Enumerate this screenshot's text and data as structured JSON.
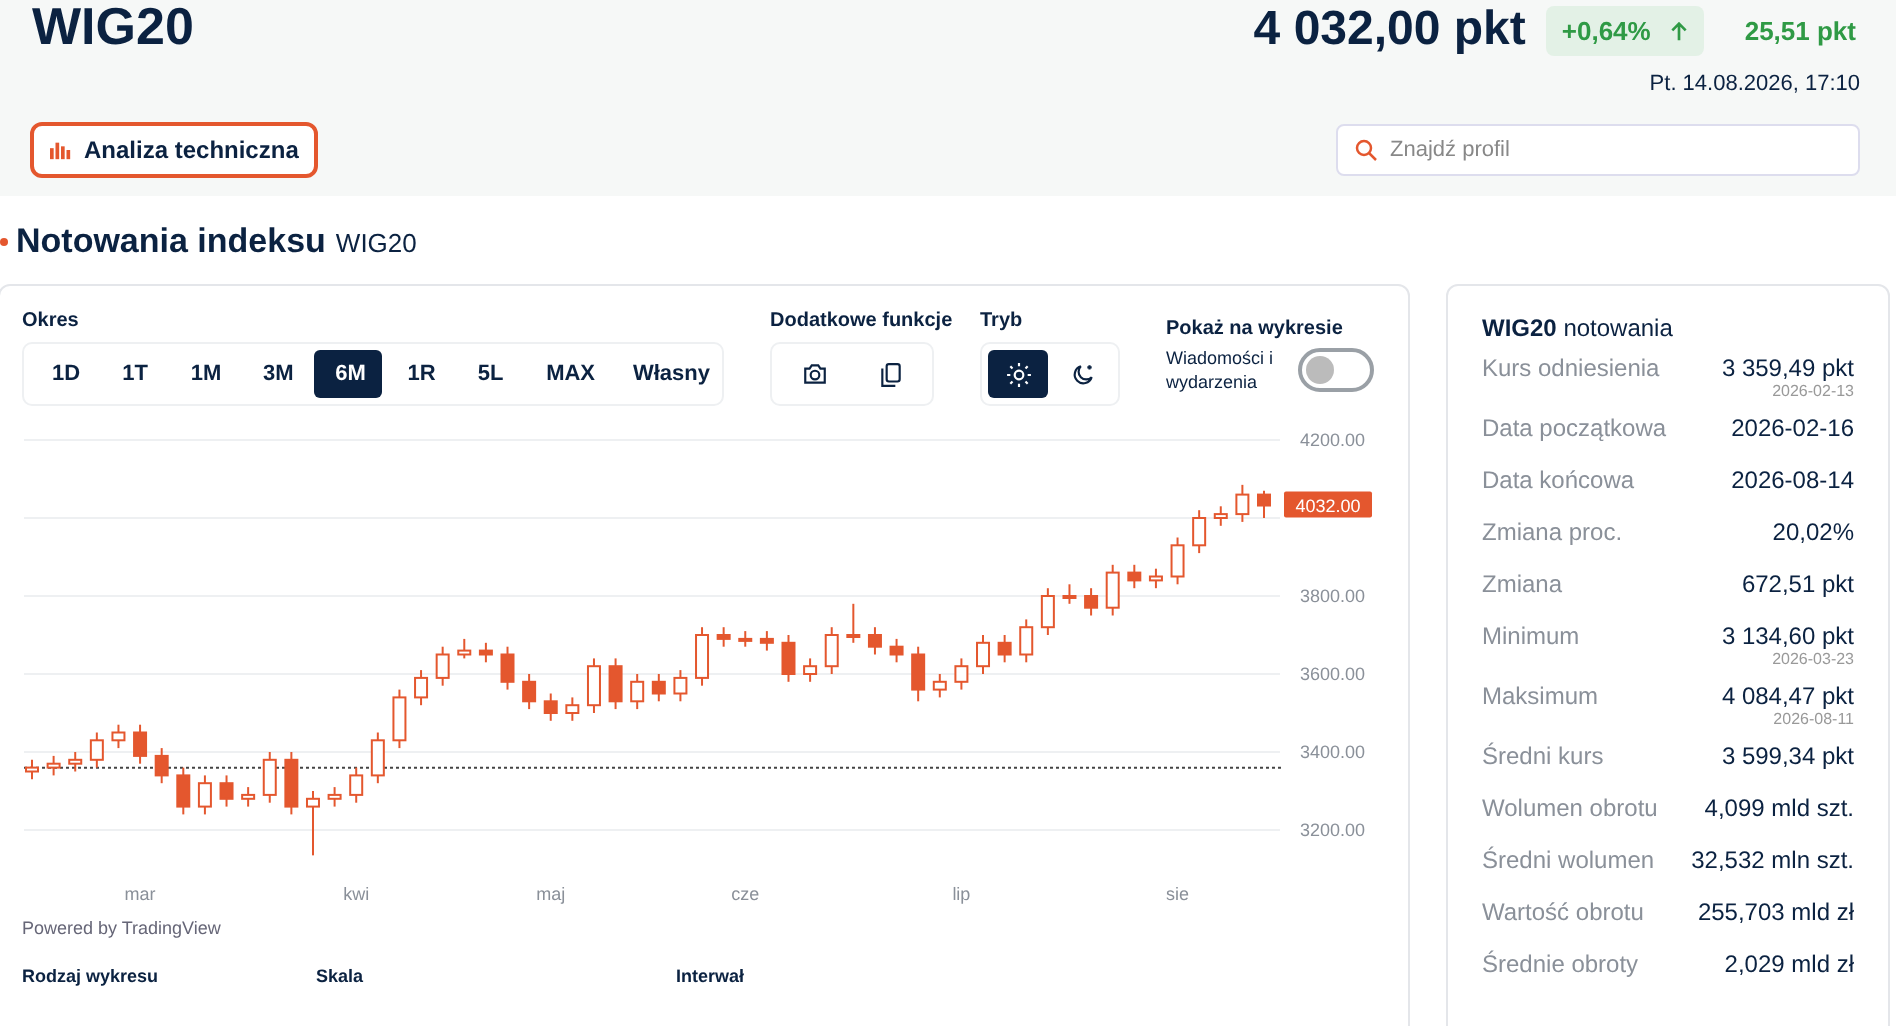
{
  "header": {
    "title": "WIG20",
    "price": "4 032,00 pkt",
    "change_pct": "+0,64%",
    "change_abs": "25,51 pkt",
    "timestamp": "Pt. 14.08.2026, 17:10",
    "analysis_button": "Analiza techniczna",
    "search": {
      "placeholder": "Znajdź profil"
    }
  },
  "section": {
    "title": "Notowania indeksu",
    "subtitle": "WIG20"
  },
  "controls": {
    "period_label": "Okres",
    "periods": [
      {
        "label": "1D",
        "selected": false
      },
      {
        "label": "1T",
        "selected": false
      },
      {
        "label": "1M",
        "selected": false
      },
      {
        "label": "3M",
        "selected": false
      },
      {
        "label": "6M",
        "selected": true
      },
      {
        "label": "1R",
        "selected": false
      },
      {
        "label": "5L",
        "selected": false
      },
      {
        "label": "MAX",
        "selected": false
      },
      {
        "label": "Własny",
        "selected": false
      }
    ],
    "extras_label": "Dodatkowe funkcje",
    "extras": [
      {
        "kind": "camera"
      },
      {
        "kind": "copy"
      }
    ],
    "mode_label": "Tryb",
    "modes": [
      {
        "kind": "light",
        "selected": true
      },
      {
        "kind": "dark",
        "selected": false
      }
    ],
    "show_label": "Pokaż na wykresie",
    "events": {
      "label": "Wiadomości i wydarzenia",
      "on": false
    }
  },
  "chart": {
    "footer": "Powered by TradingView",
    "bottom_labels": [
      "Rodzaj wykresu",
      "Skala",
      "Interwał"
    ],
    "chart_data": {
      "type": "candlestick",
      "grid": true,
      "ylim": [
        3200,
        4200
      ],
      "yticks": [
        {
          "value": 3200,
          "label": "3200.00"
        },
        {
          "value": 3400,
          "label": "3400.00"
        },
        {
          "value": 3600,
          "label": "3600.00"
        },
        {
          "value": 3800,
          "label": "3800.00"
        },
        {
          "value": 4200,
          "label": "4200.00"
        }
      ],
      "categories": [
        null,
        null,
        null,
        null,
        null,
        "mar",
        null,
        null,
        null,
        null,
        null,
        null,
        null,
        null,
        null,
        "kwi",
        null,
        null,
        null,
        null,
        null,
        null,
        null,
        null,
        "maj",
        null,
        null,
        null,
        null,
        null,
        null,
        null,
        null,
        "cze",
        null,
        null,
        null,
        null,
        null,
        null,
        null,
        null,
        null,
        "lip",
        null,
        null,
        null,
        null,
        null,
        null,
        null,
        null,
        null,
        "sie",
        null,
        null,
        null,
        null
      ],
      "ohlc": [
        [
          3350,
          3380,
          3330,
          3360
        ],
        [
          3360,
          3390,
          3340,
          3370
        ],
        [
          3370,
          3400,
          3350,
          3380
        ],
        [
          3380,
          3450,
          3360,
          3430
        ],
        [
          3430,
          3470,
          3410,
          3450
        ],
        [
          3450,
          3470,
          3370,
          3390
        ],
        [
          3390,
          3410,
          3320,
          3340
        ],
        [
          3340,
          3360,
          3240,
          3260
        ],
        [
          3260,
          3340,
          3240,
          3320
        ],
        [
          3320,
          3340,
          3260,
          3280
        ],
        [
          3280,
          3310,
          3260,
          3290
        ],
        [
          3290,
          3400,
          3270,
          3380
        ],
        [
          3380,
          3400,
          3240,
          3260
        ],
        [
          3260,
          3300,
          3135,
          3280
        ],
        [
          3280,
          3310,
          3260,
          3290
        ],
        [
          3290,
          3360,
          3270,
          3340
        ],
        [
          3340,
          3450,
          3320,
          3430
        ],
        [
          3430,
          3560,
          3410,
          3540
        ],
        [
          3540,
          3610,
          3520,
          3590
        ],
        [
          3590,
          3670,
          3570,
          3650
        ],
        [
          3650,
          3690,
          3640,
          3660
        ],
        [
          3660,
          3680,
          3630,
          3650
        ],
        [
          3650,
          3670,
          3560,
          3580
        ],
        [
          3580,
          3600,
          3510,
          3530
        ],
        [
          3530,
          3550,
          3480,
          3500
        ],
        [
          3500,
          3540,
          3480,
          3520
        ],
        [
          3520,
          3640,
          3500,
          3620
        ],
        [
          3620,
          3640,
          3510,
          3530
        ],
        [
          3530,
          3600,
          3510,
          3580
        ],
        [
          3580,
          3600,
          3530,
          3550
        ],
        [
          3550,
          3610,
          3530,
          3590
        ],
        [
          3590,
          3720,
          3570,
          3700
        ],
        [
          3700,
          3720,
          3670,
          3690
        ],
        [
          3690,
          3710,
          3670,
          3690
        ],
        [
          3690,
          3710,
          3660,
          3680
        ],
        [
          3680,
          3700,
          3580,
          3600
        ],
        [
          3600,
          3640,
          3580,
          3620
        ],
        [
          3620,
          3720,
          3600,
          3700
        ],
        [
          3700,
          3780,
          3680,
          3700
        ],
        [
          3700,
          3720,
          3650,
          3670
        ],
        [
          3670,
          3690,
          3630,
          3650
        ],
        [
          3650,
          3670,
          3530,
          3560
        ],
        [
          3560,
          3600,
          3540,
          3580
        ],
        [
          3580,
          3640,
          3560,
          3620
        ],
        [
          3620,
          3700,
          3600,
          3680
        ],
        [
          3680,
          3700,
          3630,
          3650
        ],
        [
          3650,
          3740,
          3630,
          3720
        ],
        [
          3720,
          3820,
          3700,
          3800
        ],
        [
          3800,
          3830,
          3780,
          3800
        ],
        [
          3800,
          3820,
          3750,
          3770
        ],
        [
          3770,
          3880,
          3750,
          3860
        ],
        [
          3860,
          3880,
          3820,
          3840
        ],
        [
          3840,
          3870,
          3820,
          3850
        ],
        [
          3850,
          3950,
          3830,
          3930
        ],
        [
          3930,
          4020,
          3910,
          4000
        ],
        [
          4000,
          4030,
          3980,
          4010
        ],
        [
          4010,
          4085,
          3990,
          4060
        ],
        [
          4060,
          4070,
          4000,
          4032
        ]
      ],
      "ref_lines": [
        {
          "axis": "y",
          "value": 3359.49
        }
      ],
      "annotations": [
        "4032.00"
      ]
    }
  },
  "stats": {
    "title": "WIG20",
    "title_suffix": "notowania",
    "rows": [
      {
        "label": "Kurs odniesienia",
        "value": "3 359,49 pkt",
        "date": "2026-02-13"
      },
      {
        "label": "Data początkowa",
        "value": "2026-02-16"
      },
      {
        "label": "Data końcowa",
        "value": "2026-08-14"
      },
      {
        "label": "Zmiana proc.",
        "value": "20,02%"
      },
      {
        "label": "Zmiana",
        "value": "672,51 pkt"
      },
      {
        "label": "Minimum",
        "value": "3 134,60 pkt",
        "date": "2026-03-23"
      },
      {
        "label": "Maksimum",
        "value": "4 084,47 pkt",
        "date": "2026-08-11"
      },
      {
        "label": "Średni kurs",
        "value": "3 599,34 pkt"
      },
      {
        "label": "Wolumen obrotu",
        "value": "4,099 mld szt."
      },
      {
        "label": "Średni wolumen",
        "value": "32,532 mln szt."
      },
      {
        "label": "Wartość obrotu",
        "value": "255,703 mld zł"
      },
      {
        "label": "Średnie obroty",
        "value": "2,029 mld zł"
      }
    ]
  }
}
